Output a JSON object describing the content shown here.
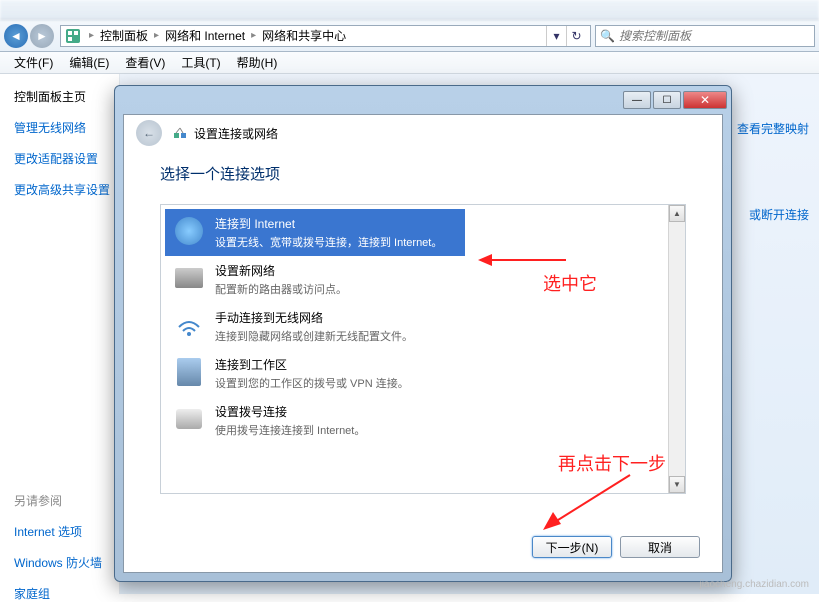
{
  "breadcrumbs": [
    "控制面板",
    "网络和 Internet",
    "网络和共享中心"
  ],
  "search_placeholder": "搜索控制面板",
  "menubar": {
    "file": "文件(F)",
    "edit": "编辑(E)",
    "view": "查看(V)",
    "tools": "工具(T)",
    "help": "帮助(H)"
  },
  "sidebar": {
    "header": "控制面板主页",
    "links": [
      "管理无线网络",
      "更改适配器设置",
      "更改高级共享设置"
    ],
    "also_label": "另请参阅",
    "also_links": [
      "Internet 选项",
      "Windows 防火墙",
      "家庭组"
    ]
  },
  "right_links": {
    "map": "查看完整映射",
    "conn": "或断开连接"
  },
  "dialog": {
    "title": "设置连接或网络",
    "heading": "选择一个连接选项",
    "options": [
      {
        "title": "连接到 Internet",
        "desc": "设置无线、宽带或拨号连接，连接到 Internet。",
        "selected": true
      },
      {
        "title": "设置新网络",
        "desc": "配置新的路由器或访问点。",
        "selected": false
      },
      {
        "title": "手动连接到无线网络",
        "desc": "连接到隐藏网络或创建新无线配置文件。",
        "selected": false
      },
      {
        "title": "连接到工作区",
        "desc": "设置到您的工作区的拨号或 VPN 连接。",
        "selected": false
      },
      {
        "title": "设置拨号连接",
        "desc": "使用拨号连接连接到 Internet。",
        "selected": false
      }
    ],
    "next_btn": "下一步(N)",
    "cancel_btn": "取消"
  },
  "annotations": {
    "select_it": "选中它",
    "click_next": "再点击下一步"
  },
  "watermark": "jiaocheng.chazidian.com"
}
